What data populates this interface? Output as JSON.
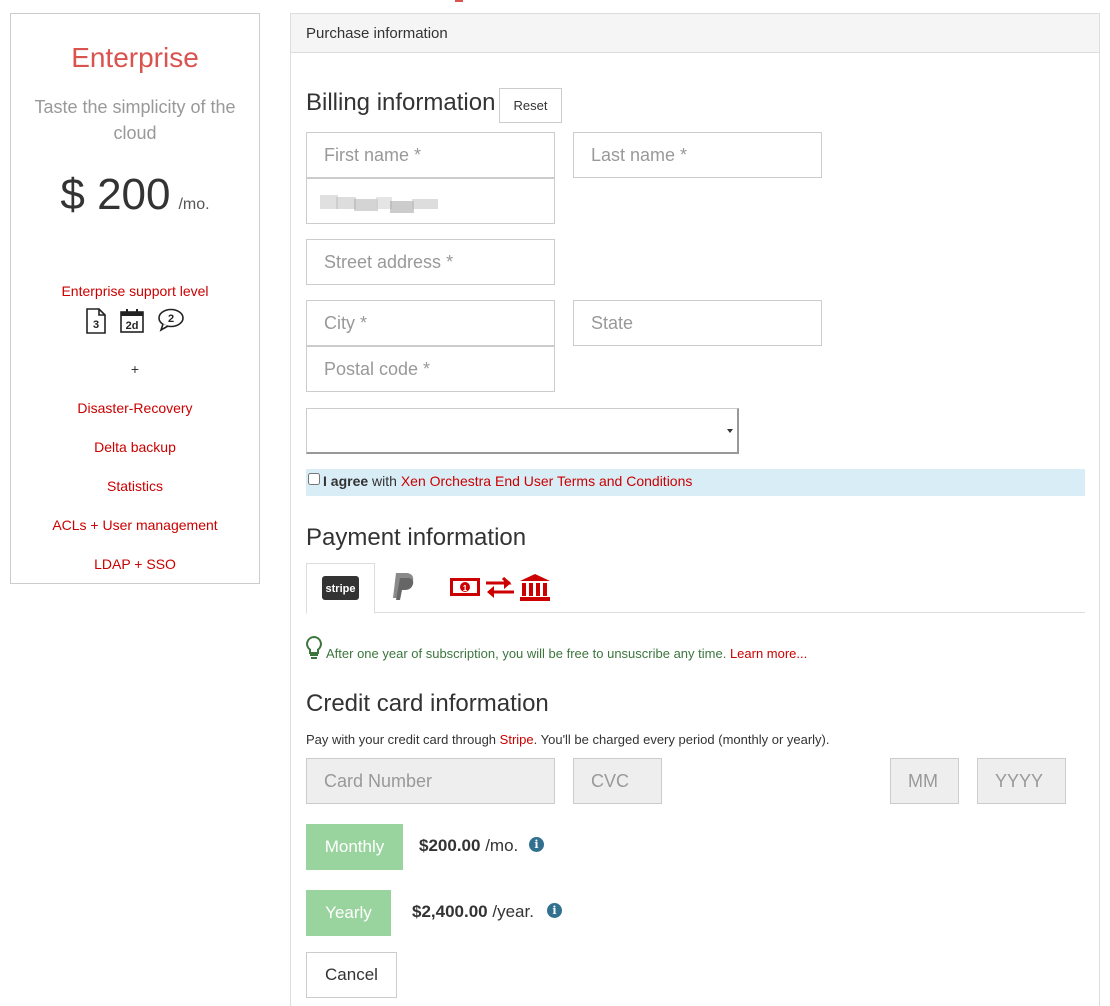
{
  "plan": {
    "name": "Enterprise",
    "tagline": "Taste the simplicity of the cloud",
    "price": "$ 200",
    "per": "/mo.",
    "support_level": "Enterprise support level",
    "support_icons": [
      "document-3-icon",
      "calendar-2d-icon",
      "chat-bubble-2-icon"
    ],
    "plus": "+",
    "features": [
      "Disaster-Recovery",
      "Delta backup",
      "Statistics",
      "ACLs + User management",
      "LDAP + SSO"
    ]
  },
  "panel": {
    "heading": "Purchase information"
  },
  "billing": {
    "title": "Billing information",
    "reset_label": "Reset",
    "first_name_placeholder": "First name *",
    "last_name_placeholder": "Last name *",
    "street_placeholder": "Street address *",
    "city_placeholder": "City *",
    "state_placeholder": "State",
    "postal_placeholder": "Postal code *",
    "agree_strong": "I agree",
    "agree_with": "with",
    "agree_link": "Xen Orchestra End User Terms and Conditions"
  },
  "payment": {
    "title": "Payment information",
    "tabs": [
      "stripe-icon",
      "paypal-icon",
      "bank-transfer-icon"
    ],
    "tab_stripe_label": "stripe",
    "tip_text": "After one year of subscription, you will be free to unsuscribe any time.",
    "tip_link": "Learn more..."
  },
  "credit_card": {
    "title": "Credit card information",
    "desc_before": "Pay with your credit card through",
    "desc_link": "Stripe",
    "desc_after": ". You'll be charged every period (monthly or yearly).",
    "card_number_placeholder": "Card Number",
    "cvc_placeholder": "CVC",
    "mm_placeholder": "MM",
    "yyyy_placeholder": "YYYY",
    "monthly_label": "Monthly",
    "monthly_amount": "$200.00",
    "monthly_per": "/mo.",
    "yearly_label": "Yearly",
    "yearly_amount": "$2,400.00",
    "yearly_per": "/year.",
    "info_glyph": "i",
    "cancel_label": "Cancel"
  },
  "colors": {
    "accent": "#c00",
    "brand_red": "#d9534f",
    "success": "#99d39e",
    "info_bg": "#d9edf7",
    "tip_green": "#3c763d"
  }
}
